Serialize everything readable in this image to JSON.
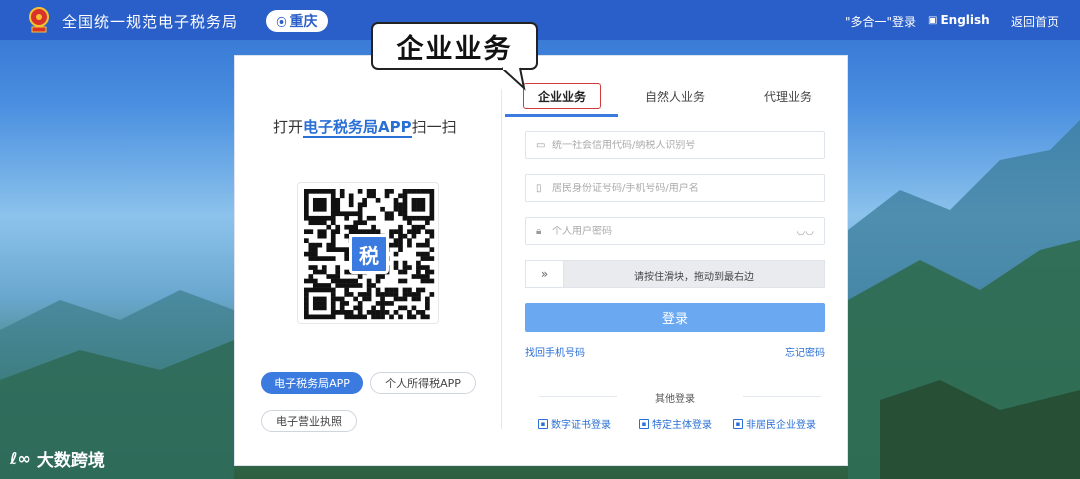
{
  "header": {
    "site_title": "全国统一规范电子税务局",
    "region": "重庆",
    "multi_login": "\"多合一\"登录",
    "english": "English",
    "back_home": "返回首页"
  },
  "callout": {
    "text": "企业业务"
  },
  "qr_panel": {
    "title_prefix": "打开",
    "title_app": "电子税务局APP",
    "title_suffix": "扫一扫",
    "qr_center_char": "税",
    "apps": [
      "电子税务局APP",
      "个人所得税APP",
      "电子营业执照"
    ],
    "active_app_index": 0
  },
  "login": {
    "tabs": [
      "企业业务",
      "自然人业务",
      "代理业务"
    ],
    "active_tab_index": 0,
    "credit_code_placeholder": "统一社会信用代码/纳税人识别号",
    "account_placeholder": "居民身份证号码/手机号码/用户名",
    "password_placeholder": "个人用户密码",
    "slider_text": "请按住滑块，拖动到最右边",
    "login_button": "登录",
    "find_phone": "找回手机号码",
    "forgot_password": "忘记密码",
    "other_login_title": "其他登录",
    "other_logins": [
      "数字证书登录",
      "特定主体登录",
      "非居民企业登录"
    ]
  },
  "watermark": {
    "text": "大数跨境"
  },
  "colors": {
    "brand_blue": "#2a5fc9",
    "accent_blue": "#3b7be0",
    "callout_red": "#d43a3a"
  }
}
